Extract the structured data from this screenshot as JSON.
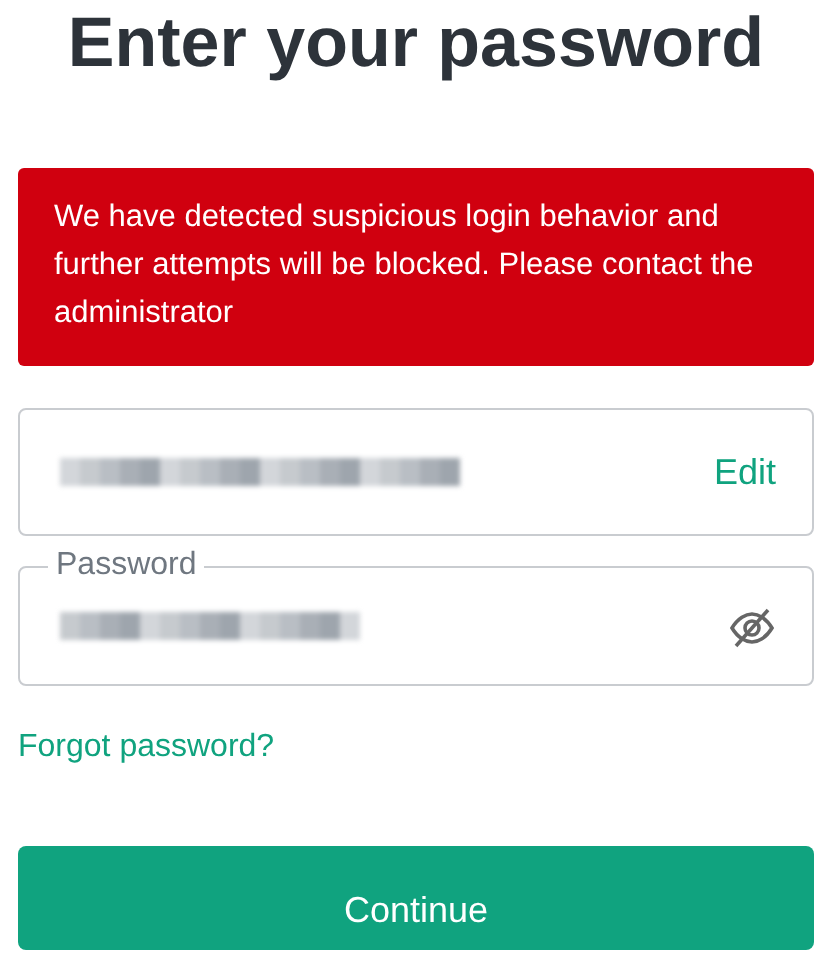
{
  "heading": "Enter your password",
  "alert": {
    "message": "We have detected suspicious login behavior and further attempts will be blocked. Please contact the administrator"
  },
  "email_field": {
    "action": "Edit"
  },
  "password_field": {
    "label": "Password",
    "visible": false
  },
  "forgot_link": "Forgot password?",
  "submit_button": "Continue"
}
